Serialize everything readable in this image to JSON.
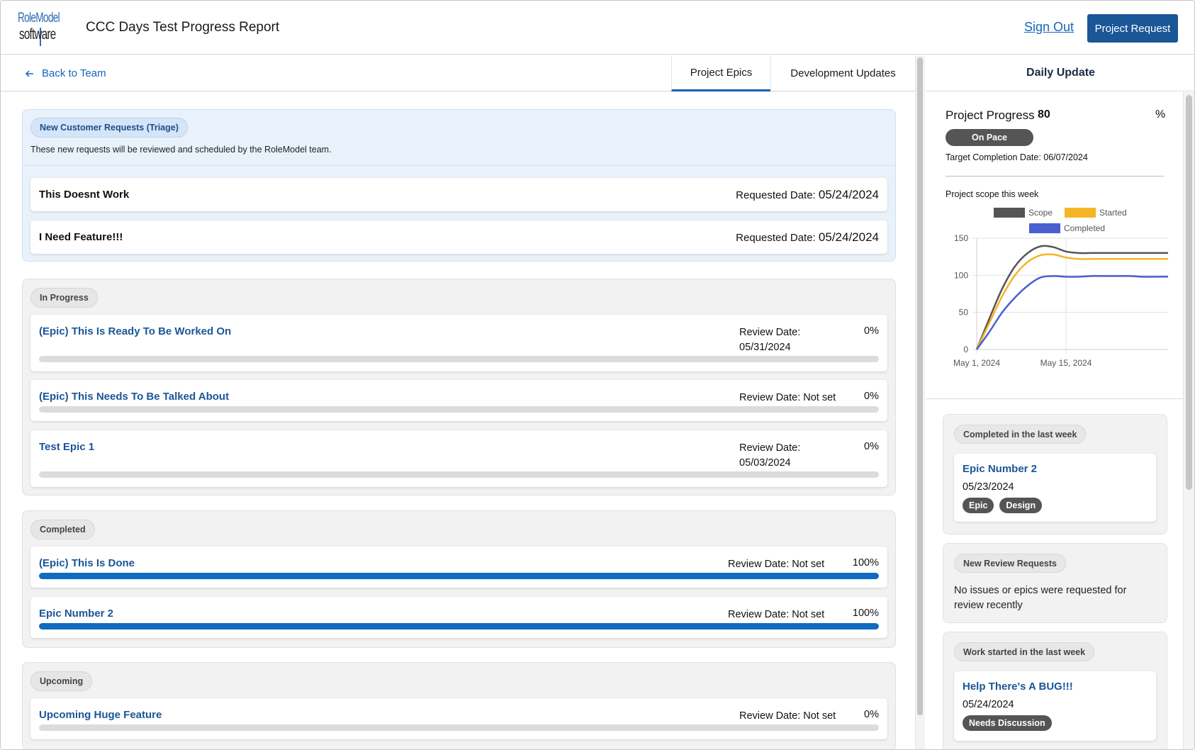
{
  "header": {
    "logo_line1": "RoleModel",
    "logo_line2": "software",
    "title": "CCC Days Test Progress Report",
    "sign_out": "Sign Out",
    "project_request": "Project Request"
  },
  "subnav": {
    "back": "Back to Team",
    "tabs": [
      {
        "label": "Project Epics",
        "active": true
      },
      {
        "label": "Development Updates",
        "active": false
      }
    ]
  },
  "triage": {
    "label": "New Customer Requests (Triage)",
    "note": "These new requests will be reviewed and scheduled by the RoleModel team.",
    "requests": [
      {
        "title": "This Doesnt Work",
        "date_label": "Requested Date:",
        "date": "05/24/2024"
      },
      {
        "title": "I Need Feature!!!",
        "date_label": "Requested Date:",
        "date": "05/24/2024"
      }
    ]
  },
  "in_progress": {
    "label": "In Progress",
    "epics": [
      {
        "title": "(Epic) This Is Ready To Be Worked On",
        "review_label": "Review Date:",
        "review_date": "05/31/2024",
        "pct_label": "0%",
        "progress": 0
      },
      {
        "title": "(Epic) This Needs To Be Talked About",
        "review": "Review Date: Not set",
        "pct_label": "0%",
        "progress": 0
      },
      {
        "title": "Test Epic 1",
        "review_label": "Review Date:",
        "review_date": "05/03/2024",
        "pct_label": "0%",
        "progress": 0
      }
    ]
  },
  "completed": {
    "label": "Completed",
    "epics": [
      {
        "title": "(Epic) This Is Done",
        "review": "Review Date: Not set",
        "pct_label": "100%",
        "progress": 100
      },
      {
        "title": "Epic Number 2",
        "review": "Review Date: Not set",
        "pct_label": "100%",
        "progress": 100
      }
    ]
  },
  "upcoming": {
    "label": "Upcoming",
    "epics": [
      {
        "title": "Upcoming Huge Feature",
        "review": "Review Date: Not set",
        "pct_label": "0%",
        "progress": 0
      }
    ]
  },
  "daily_update": {
    "title": "Daily Update",
    "progress_label": "Project Progress",
    "progress_value": "80",
    "progress_unit": "%",
    "status": "On Pace",
    "target": "Target Completion Date: 06/07/2024",
    "chart_caption": "Project scope this week",
    "completed_week": {
      "label": "Completed in the last week",
      "item_title": "Epic Number 2",
      "item_date": "05/23/2024",
      "tags": [
        "Epic",
        "Design"
      ]
    },
    "review_requests": {
      "label": "New Review Requests",
      "note": "No issues or epics were requested for review recently"
    },
    "work_started": {
      "label": "Work started in the last week",
      "item_title": "Help There's A BUG!!!",
      "item_date": "05/24/2024",
      "tags": [
        "Needs Discussion"
      ]
    }
  },
  "chart_data": {
    "type": "line",
    "x": [
      "May 1, 2024",
      "May 3, 2024",
      "May 5, 2024",
      "May 7, 2024",
      "May 9, 2024",
      "May 11, 2024",
      "May 13, 2024",
      "May 15, 2024",
      "May 17, 2024",
      "May 19, 2024",
      "May 21, 2024",
      "May 23, 2024",
      "May 25, 2024",
      "May 27, 2024",
      "May 29, 2024",
      "May 31, 2024"
    ],
    "xticks": [
      "May 1, 2024",
      "May 15, 2024"
    ],
    "ylim": [
      0,
      150
    ],
    "yticks": [
      0,
      50,
      100,
      150
    ],
    "grid": true,
    "legend_placement": "top",
    "series": [
      {
        "name": "Scope",
        "color": "#555555",
        "values": [
          0,
          42,
          82,
          112,
          130,
          139,
          138,
          132,
          130,
          130,
          130,
          130,
          130,
          130,
          130,
          130
        ]
      },
      {
        "name": "Started",
        "color": "#f4b526",
        "values": [
          0,
          36,
          72,
          100,
          118,
          127,
          128,
          124,
          122,
          122,
          122,
          122,
          122,
          122,
          122,
          122
        ]
      },
      {
        "name": "Completed",
        "color": "#4a5fd0",
        "values": [
          0,
          24,
          50,
          70,
          86,
          97,
          99,
          98,
          98,
          99,
          99,
          99,
          99,
          98,
          98,
          98
        ]
      }
    ]
  }
}
